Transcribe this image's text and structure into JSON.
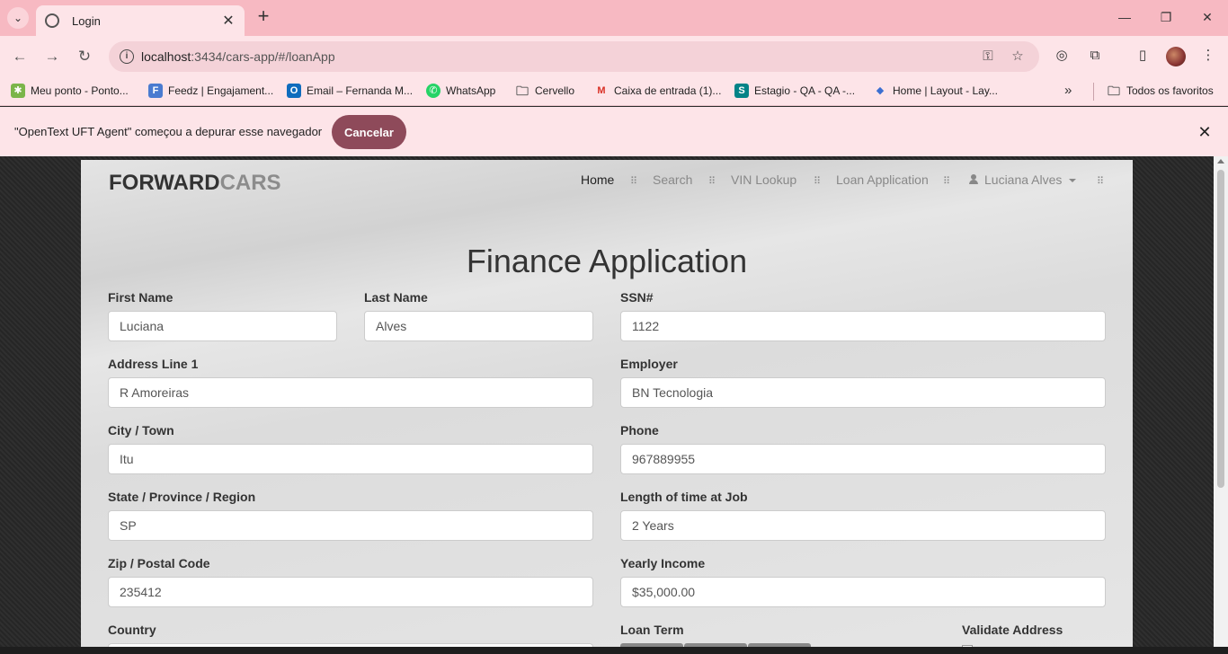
{
  "browser": {
    "tab_title": "Login",
    "url_host": "localhost",
    "url_path": ":3434/cars-app/#/loanApp",
    "bookmarks": [
      {
        "label": "Meu ponto - Ponto...",
        "icon": "pontotel-icon",
        "color": "#7bb54a"
      },
      {
        "label": "Feedz | Engajament...",
        "icon": "feedz-icon",
        "color": "#4a7bd0"
      },
      {
        "label": "Email – Fernanda M...",
        "icon": "outlook-icon",
        "color": "#0f6cbd"
      },
      {
        "label": "WhatsApp",
        "icon": "whatsapp-icon",
        "color": "#25d366"
      },
      {
        "label": "Cervello",
        "icon": "folder-icon",
        "color": "#555555"
      },
      {
        "label": "Caixa de entrada (1)...",
        "icon": "gmail-icon",
        "color": "#d93025"
      },
      {
        "label": "Estagio - QA - QA -...",
        "icon": "sharepoint-icon",
        "color": "#038387"
      },
      {
        "label": "Home | Layout - Lay...",
        "icon": "layout-icon",
        "color": "#3b6fd1"
      }
    ],
    "all_bookmarks": "Todos os favoritos",
    "infobar_message": "\"OpenText UFT Agent\" começou a depurar esse navegador",
    "cancel_label": "Cancelar"
  },
  "site": {
    "brand_a": "FORWARD",
    "brand_b": "CARS",
    "nav": {
      "home": "Home",
      "search": "Search",
      "vin": "VIN Lookup",
      "loan": "Loan Application",
      "user": "Luciana Alves"
    }
  },
  "form": {
    "title": "Finance Application",
    "first_name": {
      "label": "First Name",
      "value": "Luciana"
    },
    "last_name": {
      "label": "Last Name",
      "value": "Alves"
    },
    "ssn": {
      "label": "SSN#",
      "value": "1122"
    },
    "address": {
      "label": "Address Line 1",
      "value": "R Amoreiras"
    },
    "employer": {
      "label": "Employer",
      "value": "BN Tecnologia"
    },
    "city": {
      "label": "City / Town",
      "value": "Itu"
    },
    "phone": {
      "label": "Phone",
      "value": "967889955"
    },
    "state": {
      "label": "State / Province / Region",
      "value": "SP"
    },
    "time_at_job": {
      "label": "Length of time at Job",
      "value": "2 Years"
    },
    "zip": {
      "label": "Zip / Postal Code",
      "value": "235412"
    },
    "income": {
      "label": "Yearly Income",
      "value": "$35,000.00"
    },
    "country": {
      "label": "Country"
    },
    "loan_term": {
      "label": "Loan Term"
    },
    "validate_address": {
      "label": "Validate Address"
    }
  }
}
